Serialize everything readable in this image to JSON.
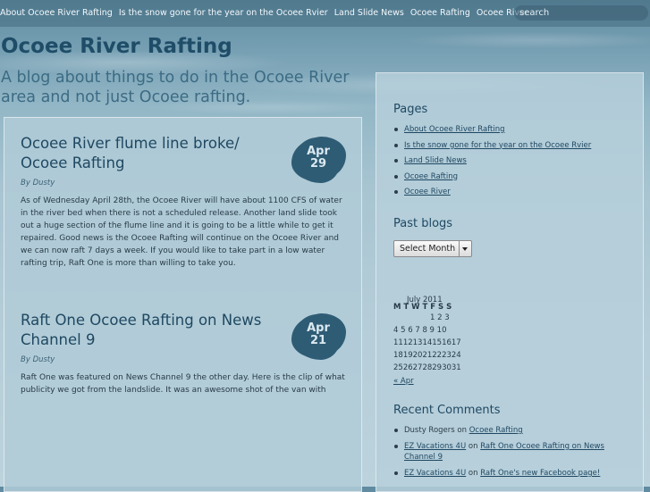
{
  "nav": {
    "links": [
      "About Ocoee River Rafting",
      "Is the snow gone for the year on the Ocoee Rvier",
      "Land Slide News",
      "Ocoee Rafting",
      "Ocoee River"
    ],
    "search_placeholder": "search"
  },
  "site": {
    "title": "Ocoee River Rafting",
    "description": "A blog about things to do in the Ocoee River area and not just Ocoee rafting."
  },
  "posts": [
    {
      "title": "Ocoee River flume line broke/ Ocoee Rafting",
      "author": "By Dusty",
      "month": "Apr",
      "day": "29",
      "body": "As of Wednesday April 28th, the Ocoee River will have about 1100 CFS of water in the river bed when there is not a scheduled release. Another land slide took out a huge section of the flume line and it is going to be a little while to get it repaired. Good news is the Ocoee Rafting will continue on the Ocoee River and we can now raft 7 days a week. If you would like to take part in a low water rafting trip, Raft One is more than willing to take you."
    },
    {
      "title": "Raft One Ocoee Rafting on News Channel 9",
      "author": "By Dusty",
      "month": "Apr",
      "day": "21",
      "body": "Raft One was featured on News Channel 9 the other day. Here is the clip of what publicity we got from the landslide. It was an awesome shot of the van with"
    }
  ],
  "sidebar": {
    "pages_title": "Pages",
    "pages": [
      "About Ocoee River Rafting",
      "Is the snow gone for the year on the Ocoee Rvier",
      "Land Slide News",
      "Ocoee Rafting",
      "Ocoee River"
    ],
    "archive_title": "Past blogs",
    "archive_select": "Select Month",
    "calendar": {
      "caption": "July 2011",
      "header": "M T W T F S S",
      "rows": [
        "1 2 3",
        "4 5 6 7 8 9 10",
        "11121314151617",
        "18192021222324",
        "25262728293031"
      ],
      "prev": "« Apr"
    },
    "comments_title": "Recent Comments",
    "comments": [
      {
        "author": "Dusty Rogers",
        "author_link": false,
        "on": "on",
        "post": "Ocoee Rafting"
      },
      {
        "author": "EZ Vacations 4U",
        "author_link": true,
        "on": "on",
        "post": "Raft One Ocoee Rafting on News Channel 9"
      },
      {
        "author": "EZ Vacations 4U",
        "author_link": true,
        "on": "on",
        "post": "Raft One's new Facebook page!"
      }
    ]
  }
}
